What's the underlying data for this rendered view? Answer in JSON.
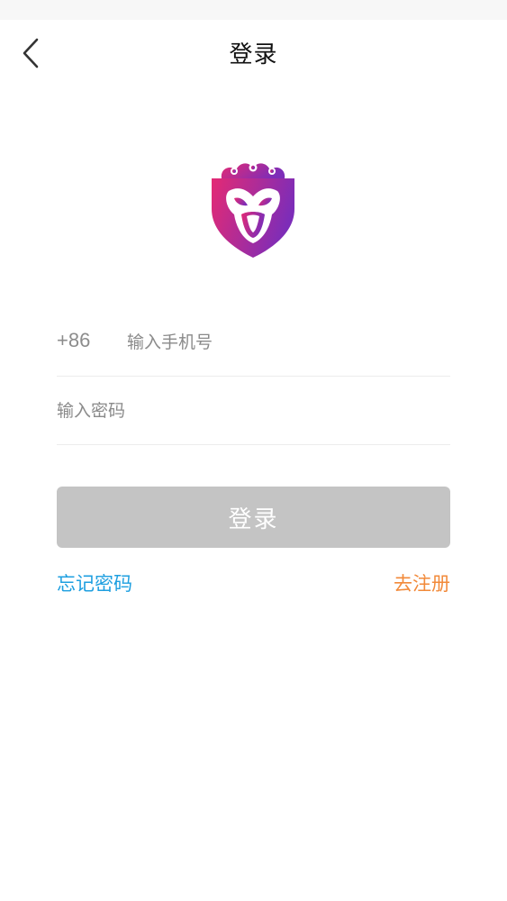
{
  "header": {
    "title": "登录",
    "back_icon": "chevron-left-icon"
  },
  "logo": {
    "icon": "monkey-shield-logo",
    "colors": [
      "#e0287a",
      "#8a2cb3"
    ]
  },
  "form": {
    "country_code": "+86",
    "phone": {
      "placeholder": "输入手机号",
      "value": ""
    },
    "password": {
      "placeholder": "输入密码",
      "value": ""
    }
  },
  "actions": {
    "login_label": "登录",
    "forgot_label": "忘记密码",
    "register_label": "去注册"
  },
  "colors": {
    "login_button_disabled": "#c4c4c4",
    "forgot_link": "#1e9fe0",
    "register_link": "#f28a3a"
  }
}
